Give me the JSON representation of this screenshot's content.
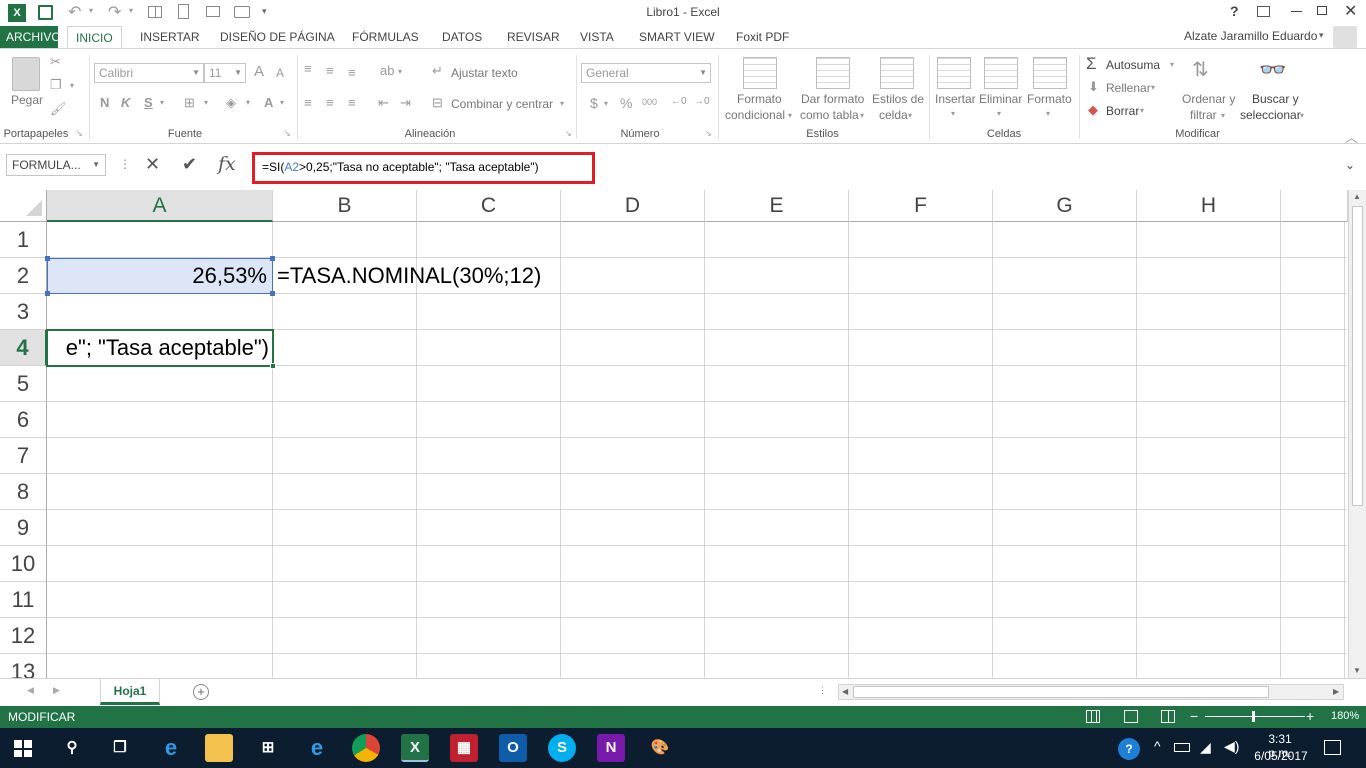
{
  "window": {
    "title": "Libro1 - Excel",
    "help_label": "?",
    "user_name": "Alzate Jaramillo Eduardo"
  },
  "tabs": [
    "ARCHIVO",
    "INICIO",
    "INSERTAR",
    "DISEÑO DE PÁGINA",
    "FÓRMULAS",
    "DATOS",
    "REVISAR",
    "VISTA",
    "SMART VIEW",
    "Foxit PDF"
  ],
  "active_tab": "INICIO",
  "ribbon": {
    "groups": {
      "portapapeles": "Portapapeles",
      "fuente": "Fuente",
      "alineacion": "Alineación",
      "numero": "Número",
      "estilos": "Estilos",
      "celdas": "Celdas",
      "modificar": "Modificar"
    },
    "paste_label": "Pegar",
    "font_name": "Calibri",
    "font_size": "11",
    "font_grow": "A",
    "font_shrink": "A",
    "bold": "N",
    "italic": "K",
    "underline": "S",
    "font_color": "A",
    "wrap_text": "Ajustar texto",
    "merge_center": "Combinar y centrar",
    "number_format": "General",
    "currency": "$",
    "percent": "%",
    "thousands": "000",
    "cond_format": [
      "Formato",
      "condicional"
    ],
    "format_table": [
      "Dar formato",
      "como tabla"
    ],
    "cell_styles": [
      "Estilos de",
      "celda"
    ],
    "insert": "Insertar",
    "delete": "Eliminar",
    "format": "Formato",
    "autosum": "Autosuma",
    "fill": "Rellenar",
    "clear": "Borrar",
    "sort_filter": [
      "Ordenar y",
      "filtrar"
    ],
    "find_select": [
      "Buscar y",
      "seleccionar"
    ]
  },
  "formula_bar": {
    "name_box": "FORMULA...",
    "fx": "fx",
    "formula_prefix": "=SI(",
    "formula_ref": "A2",
    "formula_suffix": ">0,25;\"Tasa no aceptable\"; \"Tasa aceptable\")"
  },
  "grid": {
    "columns": [
      "A",
      "B",
      "C",
      "D",
      "E",
      "F",
      "G",
      "H"
    ],
    "rows": [
      "1",
      "2",
      "3",
      "4",
      "5",
      "6",
      "7",
      "8",
      "9",
      "10",
      "11",
      "12",
      "13"
    ],
    "cells": {
      "A2": "26,53%",
      "B2": "=TASA.NOMINAL(30%;12)",
      "A4": "e\"; \"Tasa aceptable\")"
    },
    "selected_column": "A",
    "active_row": "4"
  },
  "sheets": [
    "Hoja1"
  ],
  "status": {
    "mode": "MODIFICAR",
    "zoom": "180%"
  },
  "taskbar": {
    "time": "3:31 p.m.",
    "date": "6/05/2017"
  },
  "colors": {
    "excel_green": "#217346",
    "highlight_red": "#e31b23",
    "taskbar": "#0b1d2e"
  }
}
